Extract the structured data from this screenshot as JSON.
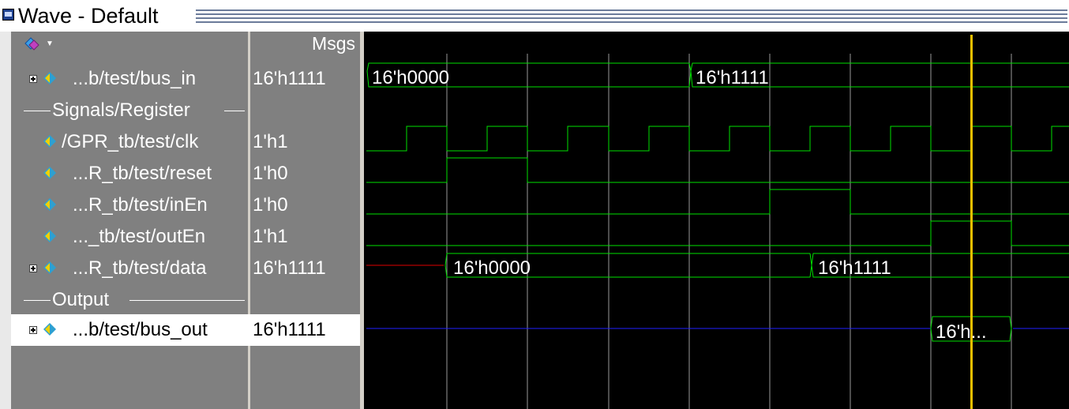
{
  "window": {
    "title": "Wave - Default"
  },
  "header": {
    "value_col": "Msgs",
    "toolbar_icon": "signal-tree-icon"
  },
  "colors": {
    "wave_bg": "#000000",
    "signal": "#00e000",
    "cursor": "#f0c000",
    "undefined": "#e00000",
    "hiz": "#2020ff",
    "grid": "#9a9a9a"
  },
  "signals": [
    {
      "name": "...b/test/bus_in",
      "value": "16'h1111",
      "expandable": true
    },
    {
      "name": "/GPR_tb/test/clk",
      "value": "1'h1",
      "expandable": false
    },
    {
      "name": "...R_tb/test/reset",
      "value": "1'h0",
      "expandable": false
    },
    {
      "name": "...R_tb/test/inEn",
      "value": "1'h0",
      "expandable": false
    },
    {
      "name": "..._tb/test/outEn",
      "value": "1'h1",
      "expandable": false
    },
    {
      "name": "...R_tb/test/data",
      "value": "16'h1111",
      "expandable": true
    },
    {
      "name": "...b/test/bus_out",
      "value": "16'h1111",
      "expandable": true
    }
  ],
  "dividers": [
    "Signals/Register",
    "Output"
  ],
  "wave_labels": {
    "bus_in": [
      "16'h0000",
      "16'h1111"
    ],
    "data": [
      "16'h0000",
      "16'h1111"
    ],
    "bus_out": [
      "16'h..."
    ]
  }
}
